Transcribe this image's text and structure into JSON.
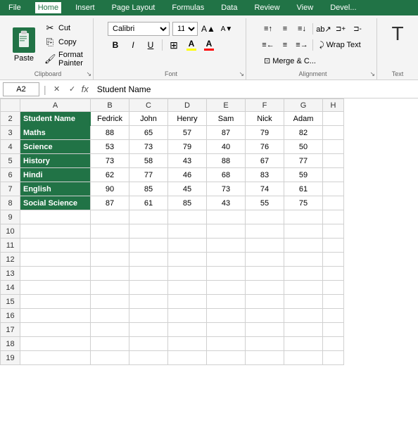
{
  "menu": {
    "items": [
      "File",
      "Home",
      "Insert",
      "Page Layout",
      "Formulas",
      "Data",
      "Review",
      "View",
      "Devel..."
    ],
    "active": "Home"
  },
  "ribbon": {
    "clipboard": {
      "label": "Clipboard",
      "paste_label": "Paste",
      "cut_label": "Cut",
      "copy_label": "Copy",
      "format_painter_label": "Format Painter"
    },
    "font": {
      "label": "Font",
      "font_name": "Calibri",
      "font_size": "11",
      "bold": "B",
      "italic": "I",
      "underline": "U",
      "increase_font": "A",
      "decrease_font": "A",
      "border_icon": "⊞",
      "fill_color": "A",
      "font_color": "A"
    },
    "alignment": {
      "label": "Alignment",
      "wrap_text": "Wrap Text",
      "merge_cells": "Merge & C..."
    },
    "text": {
      "label": "Text"
    }
  },
  "formula_bar": {
    "cell_ref": "A2",
    "formula_content": "Student Name"
  },
  "columns": [
    "",
    "A",
    "B",
    "C",
    "D",
    "E",
    "F",
    "G",
    "H"
  ],
  "rows": [
    {
      "num": "2",
      "a": "Student Name",
      "b": "Fedrick",
      "c": "John",
      "d": "Henry",
      "e": "Sam",
      "f": "Nick",
      "g": "Adam",
      "is_label_a": true
    },
    {
      "num": "3",
      "a": "Maths",
      "b": "88",
      "c": "65",
      "d": "57",
      "e": "87",
      "f": "79",
      "g": "82",
      "is_label_a": true
    },
    {
      "num": "4",
      "a": "Science",
      "b": "53",
      "c": "73",
      "d": "79",
      "e": "40",
      "f": "76",
      "g": "50",
      "is_label_a": true
    },
    {
      "num": "5",
      "a": "History",
      "b": "73",
      "c": "58",
      "d": "43",
      "e": "88",
      "f": "67",
      "g": "77",
      "is_label_a": true
    },
    {
      "num": "6",
      "a": "Hindi",
      "b": "62",
      "c": "77",
      "d": "46",
      "e": "68",
      "f": "83",
      "g": "59",
      "is_label_a": true
    },
    {
      "num": "7",
      "a": "English",
      "b": "90",
      "c": "85",
      "d": "45",
      "e": "73",
      "f": "74",
      "g": "61",
      "is_label_a": true
    },
    {
      "num": "8",
      "a": "Social Science",
      "b": "87",
      "c": "61",
      "d": "85",
      "e": "43",
      "f": "55",
      "g": "75",
      "is_label_a": true
    },
    {
      "num": "9",
      "a": "",
      "b": "",
      "c": "",
      "d": "",
      "e": "",
      "f": "",
      "g": ""
    },
    {
      "num": "10",
      "a": "",
      "b": "",
      "c": "",
      "d": "",
      "e": "",
      "f": "",
      "g": ""
    },
    {
      "num": "11",
      "a": "",
      "b": "",
      "c": "",
      "d": "",
      "e": "",
      "f": "",
      "g": ""
    },
    {
      "num": "12",
      "a": "",
      "b": "",
      "c": "",
      "d": "",
      "e": "",
      "f": "",
      "g": ""
    },
    {
      "num": "13",
      "a": "",
      "b": "",
      "c": "",
      "d": "",
      "e": "",
      "f": "",
      "g": ""
    },
    {
      "num": "14",
      "a": "",
      "b": "",
      "c": "",
      "d": "",
      "e": "",
      "f": "",
      "g": ""
    },
    {
      "num": "15",
      "a": "",
      "b": "",
      "c": "",
      "d": "",
      "e": "",
      "f": "",
      "g": ""
    },
    {
      "num": "16",
      "a": "",
      "b": "",
      "c": "",
      "d": "",
      "e": "",
      "f": "",
      "g": ""
    },
    {
      "num": "17",
      "a": "",
      "b": "",
      "c": "",
      "d": "",
      "e": "",
      "f": "",
      "g": ""
    },
    {
      "num": "18",
      "a": "",
      "b": "",
      "c": "",
      "d": "",
      "e": "",
      "f": "",
      "g": ""
    },
    {
      "num": "19",
      "a": "",
      "b": "",
      "c": "",
      "d": "",
      "e": "",
      "f": "",
      "g": ""
    }
  ],
  "colors": {
    "excel_green": "#217346",
    "ribbon_bg": "#f4f4f4",
    "border": "#d0d0d0",
    "cell_green": "#217346"
  }
}
